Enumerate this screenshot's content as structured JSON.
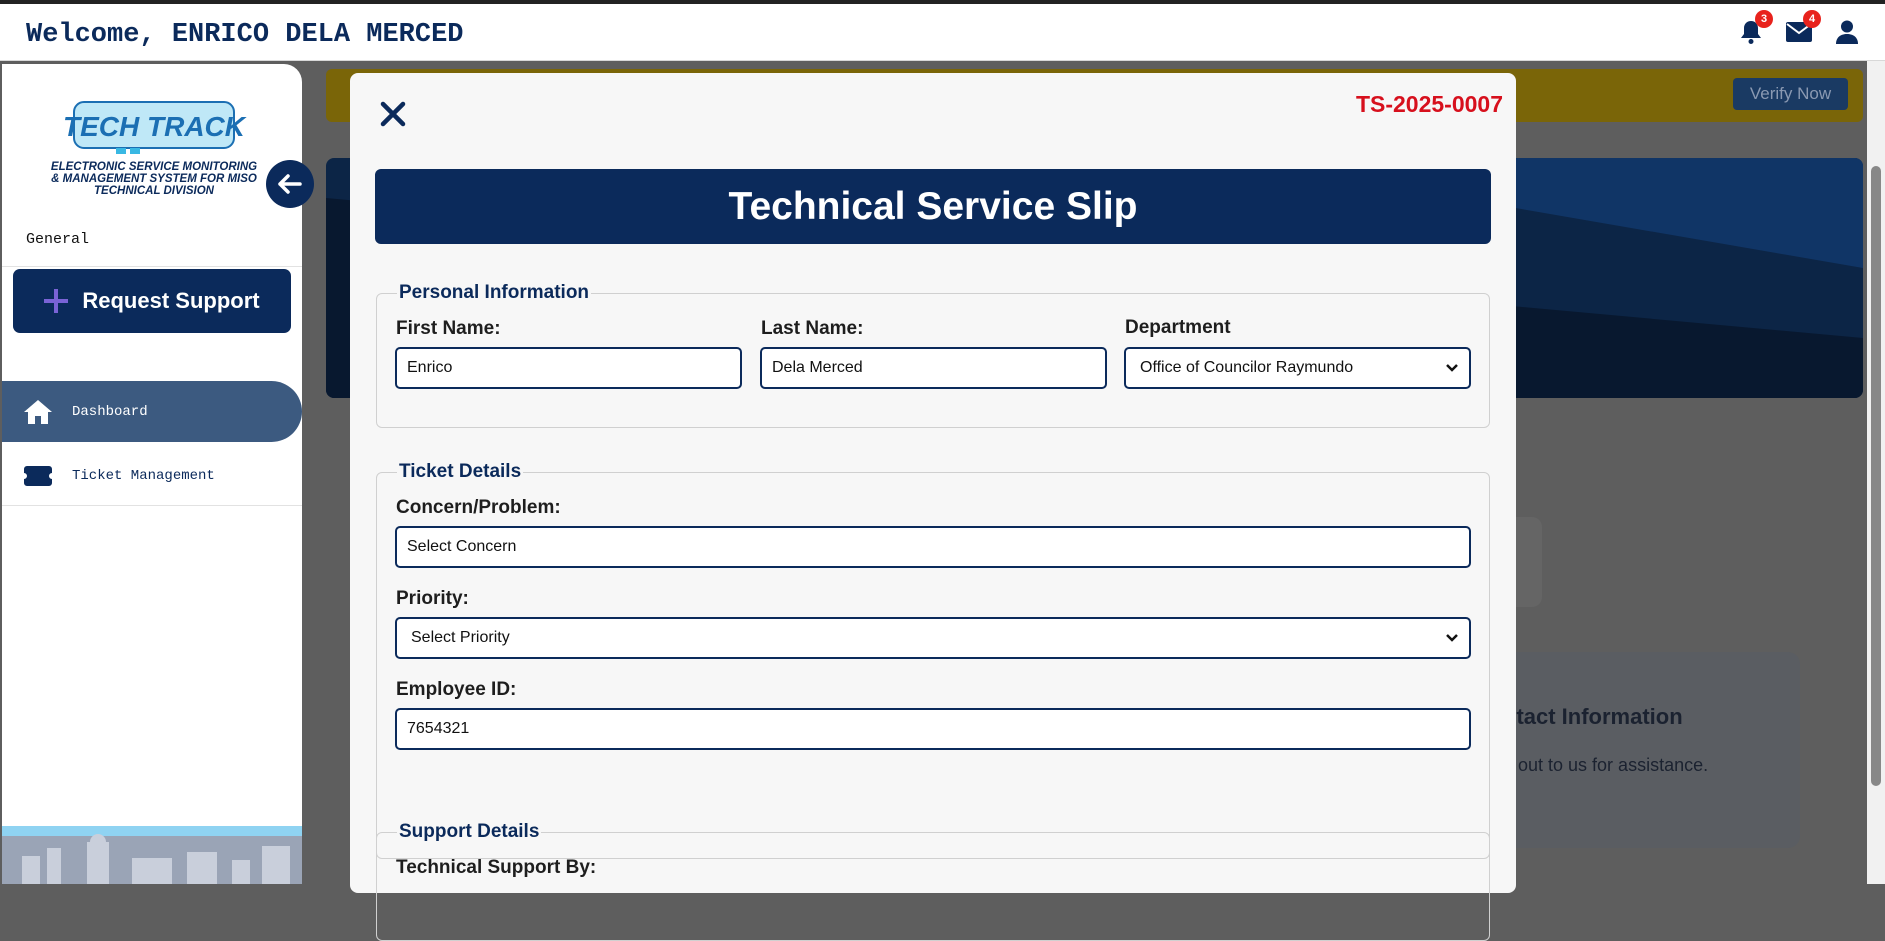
{
  "header": {
    "welcome_text": "Welcome, ENRICO DELA MERCED",
    "notifications_count": "3",
    "messages_count": "4"
  },
  "sidebar": {
    "logo_title": "TECH TRACK",
    "logo_subtitle_1": "ELECTRONIC SERVICE MONITORING",
    "logo_subtitle_2": "& MANAGEMENT SYSTEM FOR MISO",
    "logo_subtitle_3": "TECHNICAL DIVISION",
    "section_label": "General",
    "request_button": "Request Support",
    "items": [
      {
        "label": "Dashboard",
        "icon": "home-icon",
        "active": true
      },
      {
        "label": "Ticket Management",
        "icon": "ticket-icon",
        "active": false
      }
    ]
  },
  "background": {
    "verify_button": "Verify Now",
    "contact_title": "ntact Information",
    "contact_text": "out to us for assistance."
  },
  "modal": {
    "ticket_number": "TS-2025-0007",
    "title": "Technical Service Slip",
    "personal": {
      "legend": "Personal Information",
      "first_name_label": "First Name:",
      "first_name_value": "Enrico",
      "last_name_label": "Last Name:",
      "last_name_value": "Dela Merced",
      "department_label": "Department",
      "department_value": "Office of Councilor Raymundo"
    },
    "ticket": {
      "legend": "Ticket Details",
      "concern_label": "Concern/Problem:",
      "concern_value": "Select Concern",
      "priority_label": "Priority:",
      "priority_value": "Select Priority",
      "employee_id_label": "Employee ID:",
      "employee_id_value": "7654321"
    },
    "support": {
      "legend": "Support Details",
      "tech_support_label": "Technical Support By:"
    }
  },
  "colors": {
    "navy": "#0b2a5b",
    "ticket_red": "#d7101d",
    "badge_red": "#e8221c",
    "active_nav": "#3c5a80"
  }
}
